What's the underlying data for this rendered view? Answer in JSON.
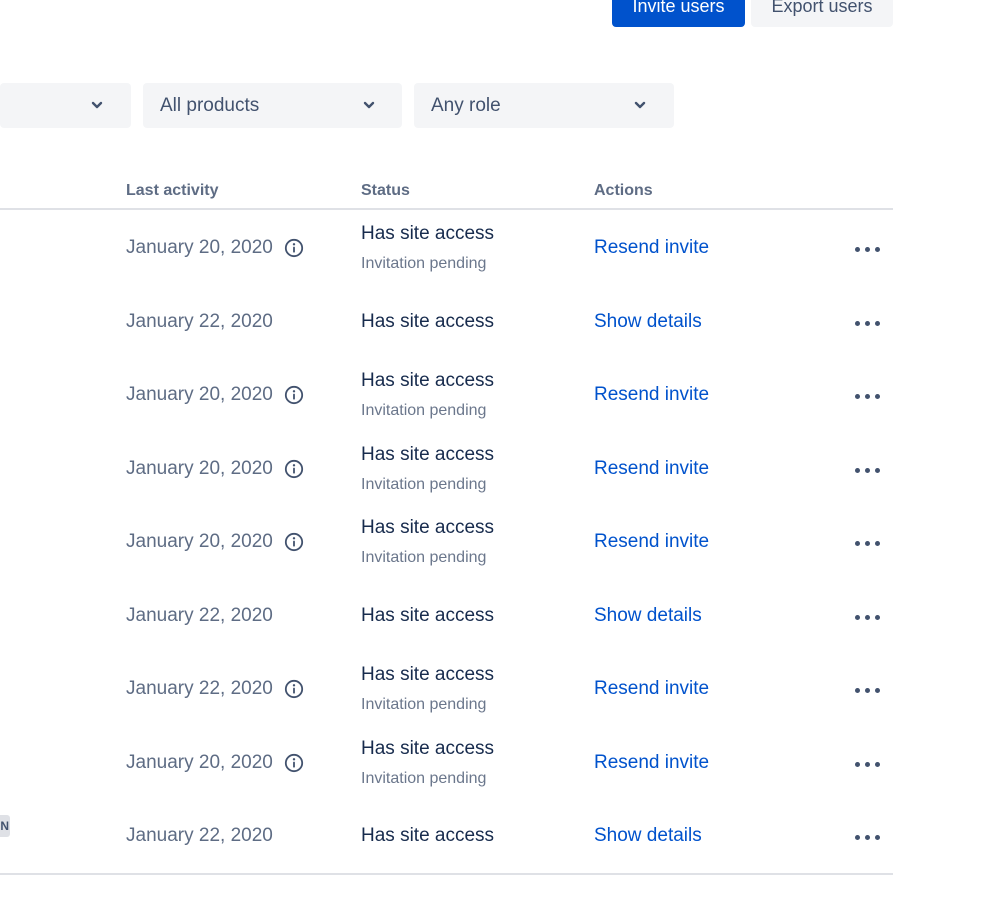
{
  "header": {
    "invite_label": "Invite users",
    "export_label": "Export users"
  },
  "filters": {
    "first_value": "",
    "products_value": "All products",
    "role_value": "Any role"
  },
  "table": {
    "columns": {
      "last_activity": "Last activity",
      "status": "Status",
      "actions": "Actions"
    },
    "rows": [
      {
        "date": "January 20, 2020",
        "info_icon": true,
        "status": "Has site access",
        "substatus": "Invitation pending",
        "action": "Resend invite"
      },
      {
        "date": "January 22, 2020",
        "info_icon": false,
        "status": "Has site access",
        "substatus": "",
        "action": "Show details"
      },
      {
        "date": "January 20, 2020",
        "info_icon": true,
        "status": "Has site access",
        "substatus": "Invitation pending",
        "action": "Resend invite"
      },
      {
        "date": "January 20, 2020",
        "info_icon": true,
        "status": "Has site access",
        "substatus": "Invitation pending",
        "action": "Resend invite"
      },
      {
        "date": "January 20, 2020",
        "info_icon": true,
        "status": "Has site access",
        "substatus": "Invitation pending",
        "action": "Resend invite"
      },
      {
        "date": "January 22, 2020",
        "info_icon": false,
        "status": "Has site access",
        "substatus": "",
        "action": "Show details"
      },
      {
        "date": "January 22, 2020",
        "info_icon": true,
        "status": "Has site access",
        "substatus": "Invitation pending",
        "action": "Resend invite"
      },
      {
        "date": "January 20, 2020",
        "info_icon": true,
        "status": "Has site access",
        "substatus": "Invitation pending",
        "action": "Resend invite"
      },
      {
        "date": "January 22, 2020",
        "info_icon": false,
        "status": "Has site access",
        "substatus": "",
        "action": "Show details"
      }
    ]
  },
  "badge_text": "N",
  "icons": {
    "chevron": "chevron-down-icon",
    "info": "info-icon",
    "more": "more-icon"
  },
  "colors": {
    "primary": "#0052cc",
    "secondary_bg": "#f4f5f7",
    "link": "#0052cc",
    "muted_text": "#5e6c84"
  }
}
